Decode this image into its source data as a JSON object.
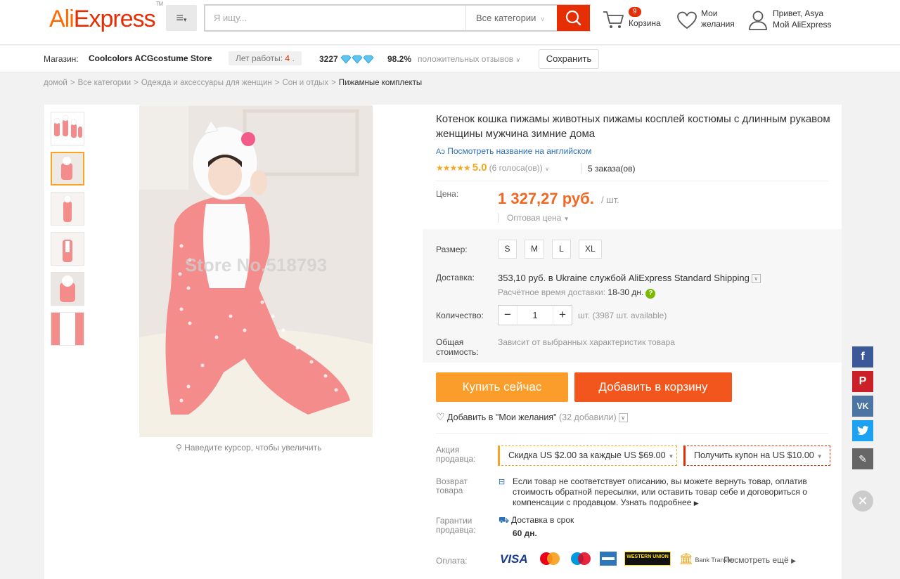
{
  "header": {
    "logo": "AliExpress",
    "search_placeholder": "Я ищу...",
    "search_category": "Все категории",
    "cart_count": "9",
    "cart_label": "Корзина",
    "wish_line1": "Мои",
    "wish_line2": "желания",
    "greeting": "Привет, Asya",
    "account": "Мой AliExpress"
  },
  "store": {
    "label": "Магазин:",
    "name": "Coolcolors ACGcostume Store",
    "years_label": "Лет работы:",
    "years": "4",
    "score": "3227",
    "positive_pct": "98.2%",
    "positive_label": "положительных отзывов",
    "save": "Сохранить"
  },
  "breadcrumb": [
    "домой",
    "Все категории",
    "Одежда и аксессуары для женщин",
    "Сон и отдых",
    "Пижамные комплекты"
  ],
  "gallery": {
    "watermark": "Store No.518793",
    "zoom_hint": "Наведите курсор, чтобы увеличить"
  },
  "product": {
    "title": "Котенок кошка пижамы животных пижамы косплей костюмы с длинным рукавом женщины мужчина зимние дома",
    "english_link": "Посмотреть название на английском",
    "rating_value": "5.0",
    "votes": "(6 голоса(ов))",
    "orders": "5 заказа(ов)",
    "price_label": "Цена:",
    "price": "1 327,27 руб.",
    "unit": "/ шт.",
    "wholesale": "Оптовая цена",
    "size_label": "Размер:",
    "sizes": [
      "S",
      "M",
      "L",
      "XL"
    ],
    "delivery_label": "Доставка:",
    "delivery": "353,10 руб. в Ukraine службой AliExpress Standard Shipping",
    "delivery_time_label": "Расчётное время доставки:",
    "delivery_time": "18-30 дн.",
    "qty_label": "Количество:",
    "qty": "1",
    "qty_note": "шт. (3987 шт. available)",
    "total_label": "Общая стоимость:",
    "total": "Зависит от выбранных характеристик товара",
    "buy_now": "Купить сейчас",
    "add_cart": "Добавить в корзину",
    "add_wish": "Добавить в \"Мои желания\"",
    "wish_count": "(32 добавили)",
    "promo_label": "Акция продавца:",
    "promo1": "Скидка US $2.00 за каждые US $69.00",
    "promo2": "Получить купон на US $10.00",
    "return_label": "Возврат товара",
    "return_text": "Если товар не соответствует описанию, вы можете вернуть товар, оплатив стоимость обратной пересылки, или оставить товар себе и договориться о компенсации с продавцом. Узнать подробнее",
    "guarantee_label": "Гарантии продавца:",
    "guarantee_text": "Доставка в срок",
    "guarantee_days": "60 дн.",
    "payment_label": "Оплата:",
    "payment_more": "Посмотреть ещё",
    "bank_transfer": "Bank Transfer",
    "visa": "VISA",
    "western_union": "WESTERN UNION"
  },
  "colors": {
    "brand_orange": "#ff6a00",
    "brand_red": "#e62e04",
    "price": "#f26722"
  }
}
